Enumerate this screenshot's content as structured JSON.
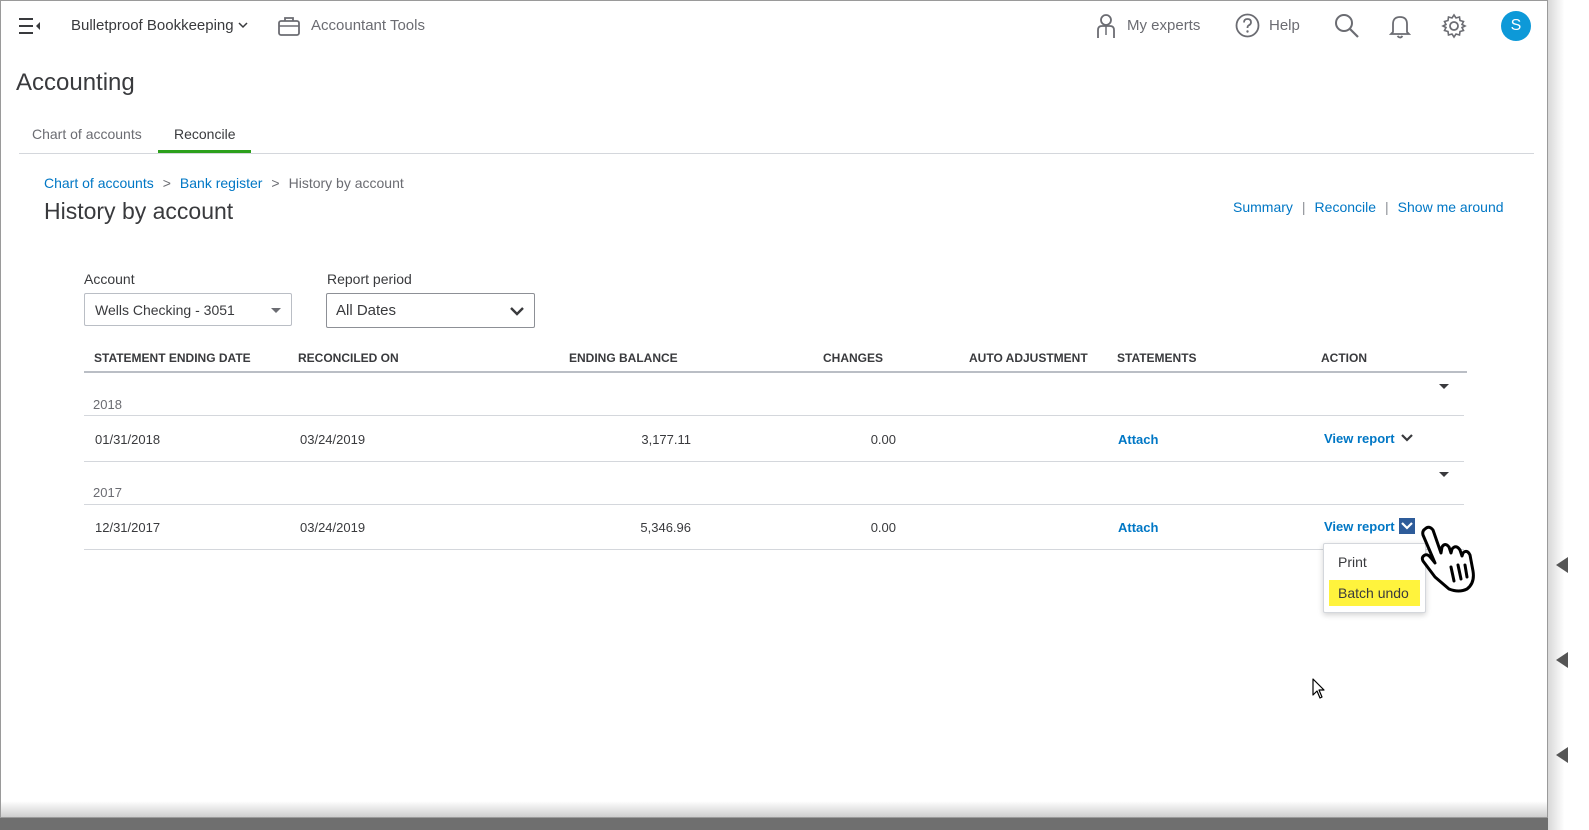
{
  "header": {
    "company_name": "Bulletproof Bookkeeping",
    "accountant_tools": "Accountant Tools",
    "my_experts": "My experts",
    "help": "Help",
    "avatar_initial": "S"
  },
  "page": {
    "title": "Accounting",
    "tabs": [
      {
        "label": "Chart of accounts",
        "active": false
      },
      {
        "label": "Reconcile",
        "active": true
      }
    ]
  },
  "breadcrumb": {
    "items": [
      "Chart of accounts",
      "Bank register"
    ],
    "current": "History by account",
    "separator": ">"
  },
  "section": {
    "title": "History by account",
    "links": [
      "Summary",
      "Reconcile",
      "Show me around"
    ]
  },
  "filters": {
    "account_label": "Account",
    "account_value": "Wells Checking - 3051",
    "period_label": "Report period",
    "period_value": "All Dates"
  },
  "table": {
    "columns": [
      "STATEMENT ENDING DATE",
      "RECONCILED ON",
      "ENDING BALANCE",
      "CHANGES",
      "AUTO ADJUSTMENT",
      "STATEMENTS",
      "ACTION"
    ],
    "groups": [
      {
        "year": "2018",
        "rows": [
          {
            "statement_date": "01/31/2018",
            "reconciled_on": "03/24/2019",
            "ending_balance": "3,177.11",
            "changes": "0.00",
            "auto_adjustment": "",
            "statements": "Attach",
            "action": "View report"
          }
        ]
      },
      {
        "year": "2017",
        "rows": [
          {
            "statement_date": "12/31/2017",
            "reconciled_on": "03/24/2019",
            "ending_balance": "5,346.96",
            "changes": "0.00",
            "auto_adjustment": "",
            "statements": "Attach",
            "action": "View report"
          }
        ]
      }
    ]
  },
  "action_menu": {
    "items": [
      "Print",
      "Batch undo"
    ],
    "highlighted": "Batch undo"
  },
  "colors": {
    "link": "#0077c5",
    "active_tab": "#2ca01c",
    "avatar": "#0d99d8",
    "highlight": "#fff33d"
  }
}
